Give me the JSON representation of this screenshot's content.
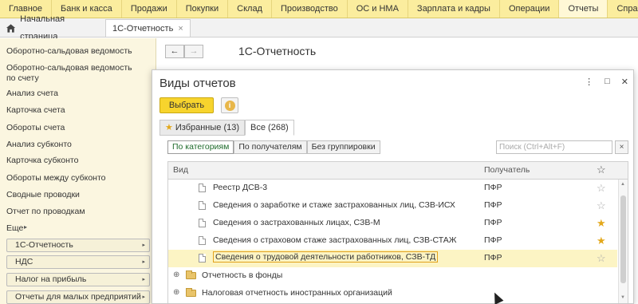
{
  "top_menu": [
    {
      "label": "Главное",
      "active": false
    },
    {
      "label": "Банк и касса",
      "active": false
    },
    {
      "label": "Продажи",
      "active": false
    },
    {
      "label": "Покупки",
      "active": false
    },
    {
      "label": "Склад",
      "active": false
    },
    {
      "label": "Производство",
      "active": false
    },
    {
      "label": "ОС и НМА",
      "active": false
    },
    {
      "label": "Зарплата и кадры",
      "active": false
    },
    {
      "label": "Операции",
      "active": false
    },
    {
      "label": "Отчеты",
      "active": true
    },
    {
      "label": "Справочни",
      "active": false
    }
  ],
  "tabs": {
    "home_label": "Начальная страница",
    "active_label": "1С-Отчетность",
    "close_glyph": "×"
  },
  "sidebar": {
    "links": [
      "Оборотно-сальдовая ведомость",
      "Оборотно-сальдовая ведомость по счету",
      "Анализ счета",
      "Карточка счета",
      "Обороты счета",
      "Анализ субконто",
      "Карточка субконто",
      "Обороты между субконто",
      "Сводные проводки",
      "Отчет по проводкам",
      "Еще"
    ],
    "sections": [
      "1С-Отчетность",
      "НДС",
      "Налог на прибыль",
      "Отчеты для малых предприятий"
    ]
  },
  "main": {
    "title": "1С-Отчетность",
    "back_glyph": "←",
    "forward_glyph": "→"
  },
  "dialog": {
    "title": "Виды отчетов",
    "controls": [
      "⋮",
      "□",
      "✕"
    ],
    "select_button": "Выбрать",
    "info_glyph": "i",
    "tabs": {
      "favorites": "Избранные (13)",
      "all": "Все (268)"
    },
    "group_buttons": [
      "По категориям",
      "По получателям",
      "Без группировки"
    ],
    "search_placeholder": "Поиск (Ctrl+Alt+F)",
    "search_clear": "×",
    "columns": {
      "name": "Вид",
      "receiver": "Получатель"
    },
    "rows": [
      {
        "type": "doc",
        "name": "Реестр ДСВ-3",
        "receiver": "ПФР",
        "favorite": false,
        "selected": false
      },
      {
        "type": "doc",
        "name": "Сведения о заработке и стаже застрахованных лиц, СЗВ-ИСХ",
        "receiver": "ПФР",
        "favorite": false,
        "selected": false
      },
      {
        "type": "doc",
        "name": "Сведения о застрахованных лицах, СЗВ-М",
        "receiver": "ПФР",
        "favorite": true,
        "selected": false
      },
      {
        "type": "doc",
        "name": "Сведения о страховом стаже застрахованных лиц, СЗВ-СТАЖ",
        "receiver": "ПФР",
        "favorite": true,
        "selected": false
      },
      {
        "type": "doc",
        "name": "Сведения о трудовой деятельности работников, СЗВ-ТД",
        "receiver": "ПФР",
        "favorite": false,
        "selected": true
      },
      {
        "type": "folder",
        "name": "Отчетность в фонды"
      },
      {
        "type": "folder",
        "name": "Налоговая отчетность иностранных организаций"
      }
    ]
  }
}
